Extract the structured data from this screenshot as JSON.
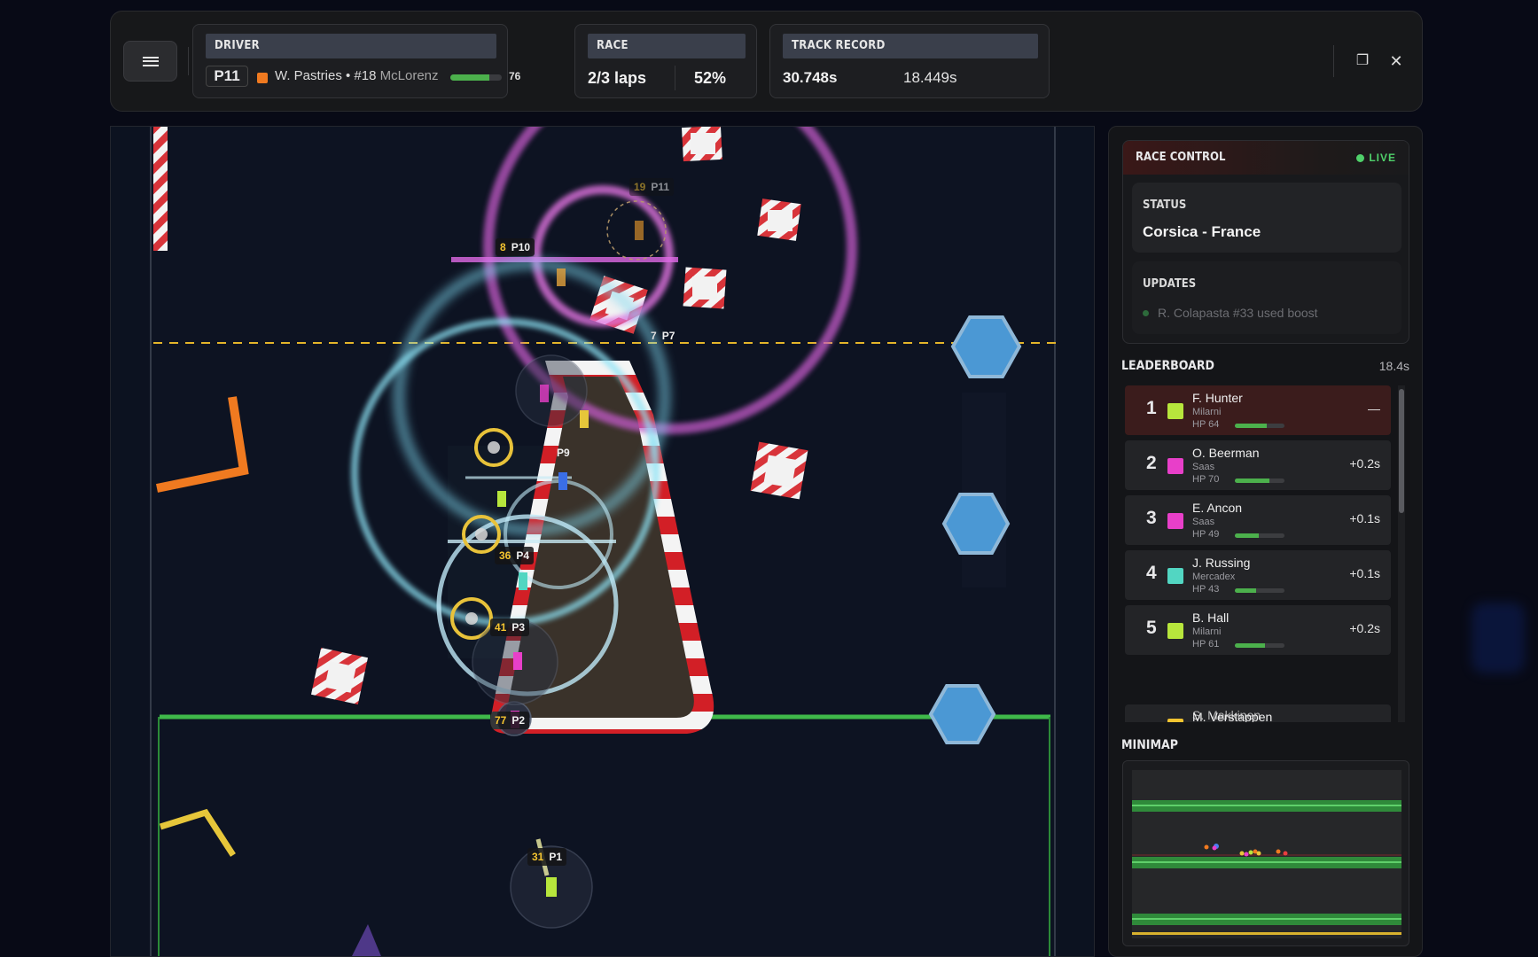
{
  "topbar": {
    "driver": {
      "header": "DRIVER",
      "position": "P11",
      "team_color": "#f07a20",
      "name_number": "W. Pastries • #18",
      "team": "McLorenz",
      "hp": 76
    },
    "race": {
      "header": "RACE",
      "laps": "2/3 laps",
      "progress": "52%"
    },
    "track_record": {
      "header": "TRACK RECORD",
      "record": "30.748s",
      "current": "18.449s"
    },
    "icons": {
      "menu": "hamburger-menu-icon",
      "window": "window-restore-icon",
      "close": "close-icon"
    },
    "close_glyph": "✕",
    "window_glyph": "❐"
  },
  "game": {
    "car_tags": [
      {
        "num": "8",
        "pos": "P10"
      },
      {
        "num": "19",
        "pos": "P11"
      },
      {
        "num": "7",
        "pos": "P7"
      },
      {
        "num": "",
        "pos": "P9"
      },
      {
        "num": "36",
        "pos": "P4"
      },
      {
        "num": "41",
        "pos": "P3"
      },
      {
        "num": "77",
        "pos": "P2"
      },
      {
        "num": "31",
        "pos": "P1"
      }
    ]
  },
  "race_control": {
    "title": "RACE CONTROL",
    "live": "LIVE",
    "status_label": "STATUS",
    "status_value": "Corsica - France",
    "updates_label": "UPDATES",
    "update_text": "R. Colapasta #33 used boost"
  },
  "leaderboard": {
    "title": "LEADERBOARD",
    "time": "18.4s",
    "rows": [
      {
        "rank": "1",
        "name": "F. Hunter",
        "team": "Milarni",
        "hp_label": "HP 64",
        "hp": 64,
        "gap": "—",
        "color": "#b7e63c"
      },
      {
        "rank": "2",
        "name": "O. Beerman",
        "team": "Saas",
        "hp_label": "HP 70",
        "hp": 70,
        "gap": "+0.2s",
        "color": "#e83fc9"
      },
      {
        "rank": "3",
        "name": "E. Ancon",
        "team": "Saas",
        "hp_label": "HP 49",
        "hp": 49,
        "gap": "+0.1s",
        "color": "#e83fc9"
      },
      {
        "rank": "4",
        "name": "J. Russing",
        "team": "Mercadex",
        "hp_label": "HP 43",
        "hp": 43,
        "gap": "+0.1s",
        "color": "#52d6c2"
      },
      {
        "rank": "5",
        "name": "B. Hall",
        "team": "Milarni",
        "hp_label": "HP 61",
        "hp": 61,
        "gap": "+0.2s",
        "color": "#b7e63c"
      }
    ],
    "partial_row": {
      "name": "M. Verstappen",
      "name_overlap": "S. Makkinen",
      "color": "#f4c430"
    }
  },
  "minimap": {
    "title": "MINIMAP"
  }
}
